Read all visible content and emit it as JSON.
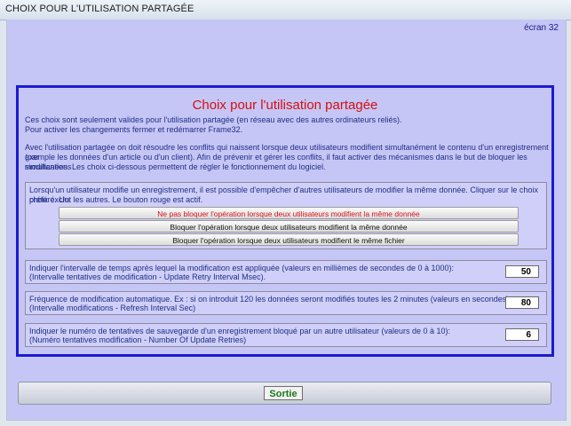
{
  "window": {
    "title": "CHOIX POUR L'UTILISATION PARTAGÉE"
  },
  "screen_label": "écran 32",
  "panel": {
    "title": "Choix pour l'utilisation partagée",
    "intro1": "Ces choix sont seulement valides pour l'utilisation partagée (en réseau avec des autres ordinateurs reliés).",
    "intro2": "Pour activer les changements fermer et redémarrer Frame32.",
    "intro3": "Avec l'utilisation partagée on doit résoudre les conflits qui naissent lorsque deux utilisateurs modifient simultanément le contenu d'un enregistrement (par",
    "intro4": "exemple les données d'un article ou d'un client).  Afin de prévenir et gérer les conflits, il faut activer des mécanismes dans le but de bloquer les modifications",
    "intro5": "simultanées. Les choix ci-dessous permettent de régler le fonctionnement du logiciel."
  },
  "locking": {
    "desc1": "Lorsqu'un utilisateur modifie un enregistrement, il est possible d'empêcher d'autres utilisateurs de modifier la même donnée. Cliquer sur le choix préféré. Un",
    "desc2": "choix exclut les autres. Le bouton rouge est actif.",
    "options": [
      {
        "label": "Ne pas bloquer l'opération lorsque deux utilisateurs modifient la même donnée",
        "active": true
      },
      {
        "label": "Bloquer l'opération lorsque deux utilisateurs modifient la même donnée",
        "active": false
      },
      {
        "label": "Bloquer l'opération lorsque deux utilisateurs modifient le même fichier",
        "active": false
      }
    ]
  },
  "settings": [
    {
      "line1": "Indiquer l'intervalle de temps après lequel la modification est appliquée (valeurs en millièmes de secondes de 0 à 1000):",
      "line2": "(Intervalle tentatives de modification - Update Retry Interval Msec).",
      "value": "50"
    },
    {
      "line1": "Fréquence de modification automatique.  Ex : si on introduit 120 les données seront modifiés toutes les 2 minutes (valeurs en secondes):",
      "line2": "(Intervalle modifications - Refresh Interval Sec)",
      "value": "80"
    },
    {
      "line1": "Indiquer le numéro de tentatives de sauvegarde d'un enregistrement bloqué par un autre utilisateur (valeurs de 0 à 10):",
      "line2": "(Numéro tentatives modification - Number Of Update Retries)",
      "value": "6"
    }
  ],
  "footer": {
    "exit_label": "Sortie"
  },
  "colors": {
    "panel_border": "#1b1bd1",
    "title_red": "#d60f0f",
    "background": "#c6c6f6",
    "exit_green": "#1a7a1a"
  }
}
